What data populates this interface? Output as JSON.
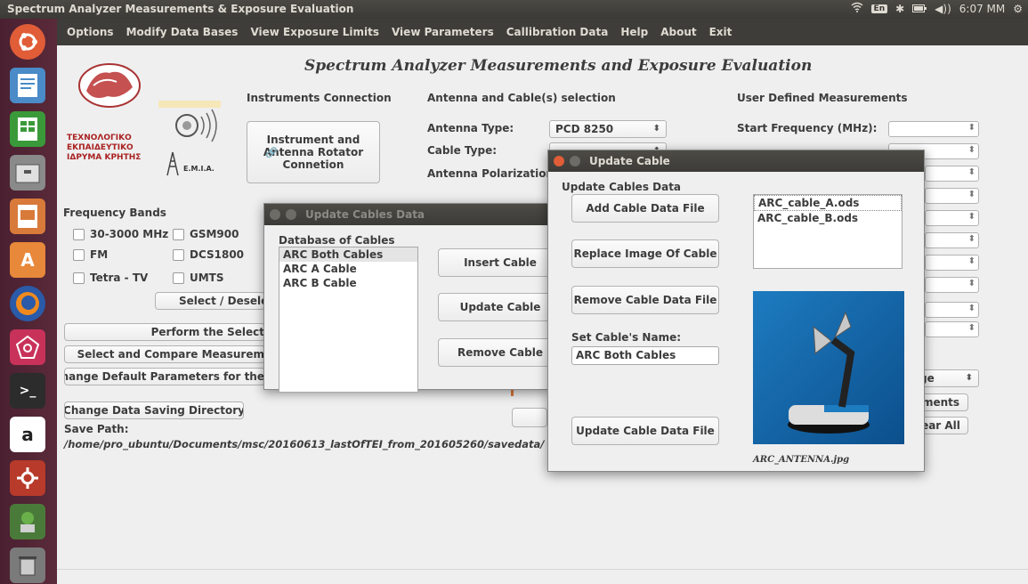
{
  "system": {
    "window_title": "Spectrum Analyzer Measurements & Exposure Evaluation",
    "keyboard_layout": "En",
    "clock": "6:07 MM"
  },
  "menu": [
    "Options",
    "Modify Data Bases",
    "View Exposure Limits",
    "View Parameters",
    "Callibration Data",
    "Help",
    "About",
    "Exit"
  ],
  "main": {
    "heading": "Spectrum Analyzer Measurements and Exposure Evaluation",
    "logo_text": [
      "ΤΕΧΝΟΛΟΓΙΚΟ",
      "ΕΚΠΑΙΔΕΥΤΙΚΟ",
      "ΙΔΡΥΜΑ ΚΡΗΤΗΣ"
    ],
    "lab_logo_text": "Ε.Μ.Ι.Α.",
    "instruments": {
      "header": "Instruments Connection",
      "connect_button": "Instrument and\n Antenna Rotator\nConnetion"
    },
    "antenna": {
      "header": "Antenna and Cable(s) selection",
      "antenna_type_label": "Antenna Type:",
      "antenna_type_value": "PCD 8250",
      "cable_type_label": "Cable Type:",
      "polarization_label": "Antenna Polarization:"
    },
    "user_defined": {
      "header": "User Defined Measurements",
      "start_freq_label": "Start Frequency (MHz):",
      "partial_combo_text": "ge",
      "btn_elements_partial": "ments",
      "btn_clear_partial": "ear All"
    },
    "frequency_bands": {
      "header": "Frequency Bands",
      "col1": [
        "30-3000 MHz",
        "FM",
        "Tetra - TV"
      ],
      "col2": [
        "GSM900",
        "DCS1800",
        "UMTS"
      ],
      "select_deselect": "Select / Deselect"
    },
    "buttons": {
      "perform": "Perform the Select",
      "select_compare": "Select and Compare Measurem",
      "change_defaults": "Change Default Parameters for the",
      "change_saving": "Change Data Saving Directory"
    },
    "save_path_label": "Save Path:",
    "save_path": "/home/pro_ubuntu/Documents/msc/20160613_lastOfTEI_from_201605260/savedata/"
  },
  "dialog_cables": {
    "title": "Update Cables Data",
    "db_label": "Database of Cables",
    "items": [
      "ARC Both Cables",
      "ARC A Cable",
      "ARC B Cable"
    ],
    "insert_button": "Insert Cable",
    "update_button": "Update Cable",
    "remove_button": "Remove Cable"
  },
  "dialog_update": {
    "title": "Update Cable",
    "section_label": "Update Cables Data",
    "add_button": "Add Cable Data File",
    "replace_button": "Replace Image Of Cable",
    "remove_button": "Remove Cable Data File",
    "name_label": "Set Cable's Name:",
    "name_value": "ARC Both Cables",
    "update_button": "Update Cable Data File",
    "files": [
      "ARC_cable_A.ods",
      "ARC_cable_B.ods"
    ],
    "image_caption": "ARC_ANTENNA.jpg"
  },
  "colors": {
    "launcher": "#5a2a3a",
    "menubar": "#3e3d39",
    "close_button": "#e05d38"
  }
}
